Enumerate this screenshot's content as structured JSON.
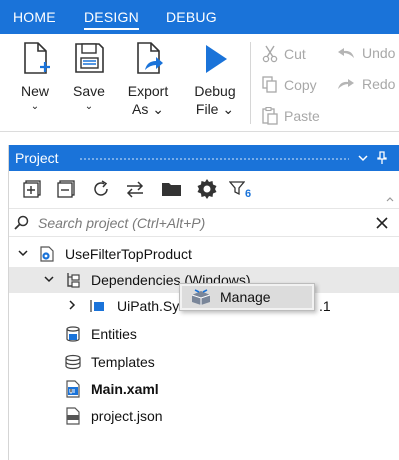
{
  "menu_tabs": [
    {
      "label": "HOME"
    },
    {
      "label": "DESIGN"
    },
    {
      "label": "DEBUG"
    }
  ],
  "ribbon": {
    "new": {
      "label": "New",
      "chevron": "⌄"
    },
    "save": {
      "label": "Save",
      "chevron": "⌄"
    },
    "export": {
      "label_line1": "Export",
      "label_line2": "As ⌄"
    },
    "debug": {
      "label_line1": "Debug",
      "label_line2": "File ⌄"
    },
    "cut": "Cut",
    "copy": "Copy",
    "paste": "Paste",
    "undo": "Undo",
    "redo": "Redo"
  },
  "project_panel": {
    "title": "Project",
    "filter_count": "6",
    "search_placeholder": "Search project (Ctrl+Alt+P)",
    "tree": {
      "root": "UseFilterTopProduct",
      "dependencies": "Dependencies (Windows)",
      "uipath_package_left": "UiPath.Sy",
      "uipath_package_right": ".1",
      "entities": "Entities",
      "templates": "Templates",
      "main": "Main.xaml",
      "project_json": "project.json"
    }
  },
  "context_menu": {
    "manage": "Manage"
  },
  "colors": {
    "accent": "#1a73d9",
    "ribbon_icon_blue": "#1a73d9"
  }
}
